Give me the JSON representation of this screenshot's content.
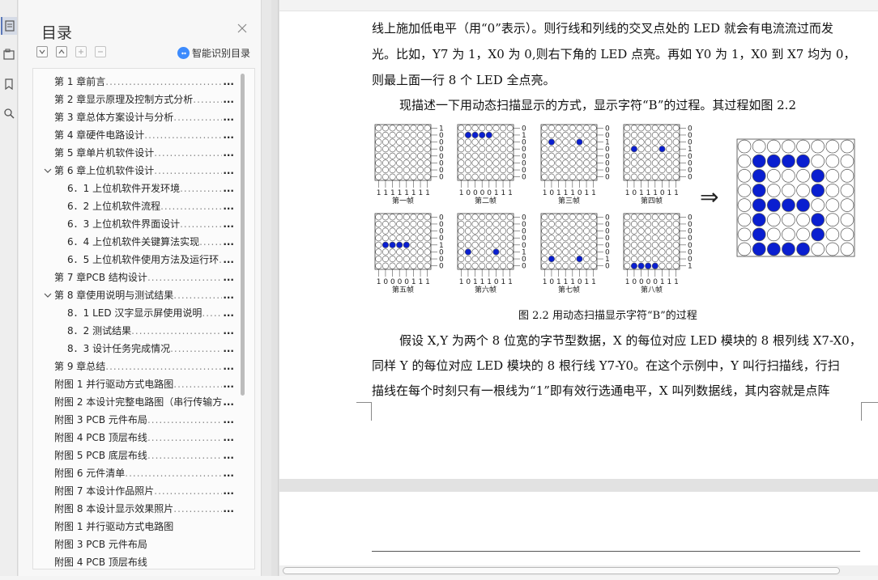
{
  "panel": {
    "title": "目录",
    "smart_label": "智能识别目录"
  },
  "toc": [
    {
      "label": "第 1 章前言",
      "level": 0,
      "caret": ""
    },
    {
      "label": "第 2 章显示原理及控制方式分析",
      "level": 0,
      "caret": ""
    },
    {
      "label": "第 3 章总体方案设计与分析",
      "level": 0,
      "caret": ""
    },
    {
      "label": "第 4 章硬件电路设计",
      "level": 0,
      "caret": ""
    },
    {
      "label": "第 5 章单片机软件设计",
      "level": 0,
      "caret": ""
    },
    {
      "label": "第 6 章上位机软件设计",
      "level": 0,
      "caret": "expanded"
    },
    {
      "label": "6．1 上位机软件开发环境",
      "level": 1,
      "caret": ""
    },
    {
      "label": "6．2 上位机软件流程",
      "level": 1,
      "caret": ""
    },
    {
      "label": "6．3 上位机软件界面设计",
      "level": 1,
      "caret": ""
    },
    {
      "label": "6．4 上位机软件关键算法实现",
      "level": 1,
      "caret": ""
    },
    {
      "label": "6．5 上位机软件使用方法及运行环",
      "level": 1,
      "caret": ""
    },
    {
      "label": "第 7 章PCB 结构设计",
      "level": 0,
      "caret": ""
    },
    {
      "label": "第 8 章使用说明与测试结果",
      "level": 0,
      "caret": "expanded"
    },
    {
      "label": "8．1 LED 汉字显示屏使用说明",
      "level": 1,
      "caret": ""
    },
    {
      "label": "8．2 测试结果",
      "level": 1,
      "caret": ""
    },
    {
      "label": "8．3 设计任务完成情况",
      "level": 1,
      "caret": ""
    },
    {
      "label": "第 9 章总结",
      "level": 0,
      "caret": ""
    },
    {
      "label": "附图 1 并行驱动方式电路图",
      "level": 0,
      "caret": ""
    },
    {
      "label": "附图 2 本设计完整电路图（串行传输方",
      "level": 0,
      "caret": ""
    },
    {
      "label": "附图 3 PCB 元件布局",
      "level": 0,
      "caret": ""
    },
    {
      "label": "附图 4 PCB 顶层布线",
      "level": 0,
      "caret": ""
    },
    {
      "label": "附图 5 PCB 底层布线",
      "level": 0,
      "caret": ""
    },
    {
      "label": "附图 6 元件清单",
      "level": 0,
      "caret": ""
    },
    {
      "label": "附图 7 本设计作品照片",
      "level": 0,
      "caret": ""
    },
    {
      "label": "附图 8 本设计显示效果照片",
      "level": 0,
      "caret": ""
    },
    {
      "label": "附图 1 并行驱动方式电路图",
      "level": 0,
      "caret": "",
      "nodots": true
    },
    {
      "label": "附图 3 PCB 元件布局",
      "level": 0,
      "caret": "",
      "nodots": true
    },
    {
      "label": "附图 4 PCB 顶层布线",
      "level": 0,
      "caret": "",
      "nodots": true
    }
  ],
  "document": {
    "para1": "线上施加低电平（用“0”表示）。则行线和列线的交叉点处的 LED 就会有电流流过而发",
    "para2": "光。比如，Y7 为 1，X0 为 0,则右下角的 LED 点亮。再如 Y0 为 1，X0 到 X7 均为 0，",
    "para3": "则最上面一行 8 个 LED 全点亮。",
    "para4": "现描述一下用动态扫描显示的方式，显示字符“B”的过程。其过程如图 2.2",
    "caption": "图 2.2 用动态扫描显示字符“B”的过程",
    "para5": "假设 X,Y 为两个 8 位宽的字节型数据，X 的每位对应 LED 模块的 8 根列线 X7-X0，",
    "para6": "同样 Y 的每位对应 LED 模块的 8 根行线 Y7-Y0。在这个示例中，Y 叫行扫描线，行扫",
    "para7": "描线在每个时刻只有一根线为“1”即有效行选通电平，X 叫列数据线，其内容就是点阵"
  },
  "figure": {
    "arrow": "⇒",
    "frames": [
      {
        "name": "第一帧",
        "bits": "11111111",
        "rows": "10000000",
        "lit_row": 0,
        "lit_cols": []
      },
      {
        "name": "第二帧",
        "bits": "10000111",
        "rows": "01000000",
        "lit_row": 1,
        "lit_cols": [
          1,
          2,
          3,
          4
        ]
      },
      {
        "name": "第三帧",
        "bits": "10111011",
        "rows": "00100000",
        "lit_row": 2,
        "lit_cols": [
          1,
          5
        ]
      },
      {
        "name": "第四帧",
        "bits": "10111011",
        "rows": "00010000",
        "lit_row": 3,
        "lit_cols": [
          1,
          5
        ]
      },
      {
        "name": "第五帧",
        "bits": "10000111",
        "rows": "00001000",
        "lit_row": 4,
        "lit_cols": [
          1,
          2,
          3,
          4
        ]
      },
      {
        "name": "第六帧",
        "bits": "10111011",
        "rows": "00000100",
        "lit_row": 5,
        "lit_cols": [
          1,
          5
        ]
      },
      {
        "name": "第七帧",
        "bits": "10111011",
        "rows": "00000010",
        "lit_row": 6,
        "lit_cols": [
          1,
          5
        ]
      },
      {
        "name": "第八帧",
        "bits": "10000111",
        "rows": "00000001",
        "lit_row": 7,
        "lit_cols": [
          1,
          2,
          3,
          4
        ]
      }
    ],
    "result_lit": [
      [],
      [
        1,
        2,
        3,
        4
      ],
      [
        1,
        5
      ],
      [
        1,
        5
      ],
      [
        1,
        2,
        3,
        4
      ],
      [
        1,
        5
      ],
      [
        1,
        5
      ],
      [
        1,
        2,
        3,
        4
      ]
    ],
    "led_on_color": "#0a1fd0"
  }
}
